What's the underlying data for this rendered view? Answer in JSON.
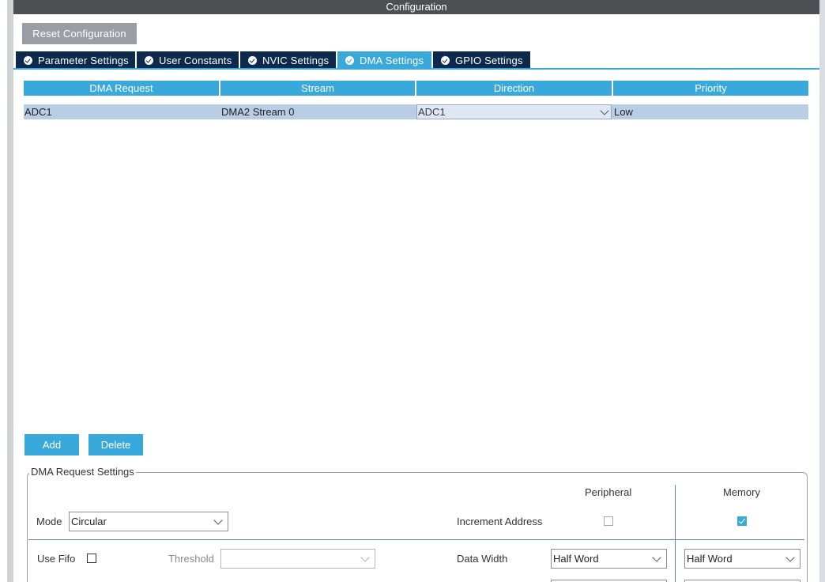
{
  "window": {
    "title": "Configuration"
  },
  "toolbar": {
    "reset_label": "Reset Configuration"
  },
  "tabs": [
    {
      "label": "Parameter Settings",
      "active": false
    },
    {
      "label": "User Constants",
      "active": false
    },
    {
      "label": "NVIC Settings",
      "active": false
    },
    {
      "label": "DMA Settings",
      "active": true
    },
    {
      "label": "GPIO Settings",
      "active": false
    }
  ],
  "table": {
    "headers": [
      "DMA Request",
      "Stream",
      "Direction",
      "Priority"
    ],
    "rows": [
      {
        "request": "ADC1",
        "stream": "DMA2 Stream 0",
        "direction": "ADC1",
        "priority": "Low"
      }
    ]
  },
  "actions": {
    "add_label": "Add",
    "delete_label": "Delete"
  },
  "request_settings": {
    "legend": "DMA Request Settings",
    "peripheral_header": "Peripheral",
    "memory_header": "Memory",
    "mode_label": "Mode",
    "mode_value": "Circular",
    "increment_address_label": "Increment Address",
    "peripheral_increment_checked": false,
    "memory_increment_checked": true,
    "use_fifo_label": "Use Fifo",
    "use_fifo_checked": false,
    "threshold_label": "Threshold",
    "threshold_value": "",
    "data_width_label": "Data Width",
    "peripheral_data_width": "Half Word",
    "memory_data_width": "Half Word"
  },
  "colors": {
    "accent": "#39a9dc",
    "tab_dark": "#0d2a4c",
    "titlebar": "#4e4f52",
    "reset_button": "#9a9ea4",
    "row_selected": "#b9cde4"
  }
}
